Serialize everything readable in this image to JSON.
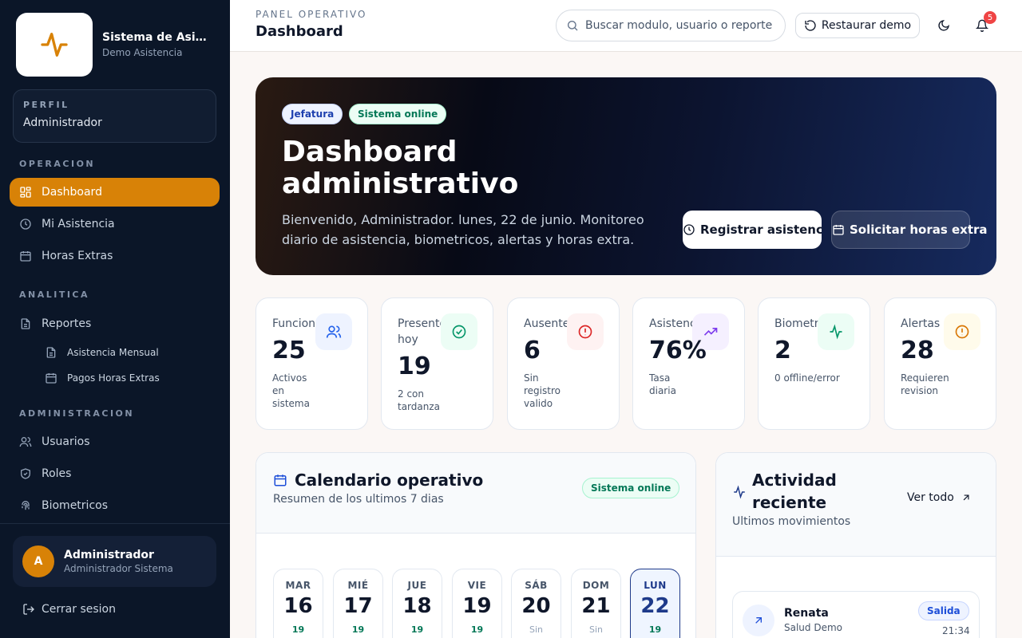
{
  "brand": {
    "title": "Sistema de Asistencia",
    "subtitle": "Demo Asistencia"
  },
  "profile": {
    "label": "PERFIL",
    "value": "Administrador"
  },
  "sidebar": {
    "sections": {
      "operacion": "OPERACION",
      "analitica": "ANALITICA",
      "administracion": "ADMINISTRACION"
    },
    "items": {
      "dashboard": "Dashboard",
      "mi_asistencia": "Mi Asistencia",
      "horas_extras": "Horas Extras",
      "reportes": "Reportes",
      "asistencia_mensual": "Asistencia Mensual",
      "pagos_horas_extras": "Pagos Horas Extras",
      "usuarios": "Usuarios",
      "roles": "Roles",
      "biometricos": "Biometricos"
    },
    "user": {
      "initial": "A",
      "name": "Administrador",
      "role": "Administrador Sistema"
    },
    "logout": "Cerrar sesion"
  },
  "header": {
    "breadcrumb": "PANEL OPERATIVO",
    "title": "Dashboard",
    "search_placeholder": "Buscar modulo, usuario o reporte",
    "restore_label": "Restaurar demo",
    "notification_count": "5"
  },
  "hero": {
    "badge_role": "Jefatura",
    "badge_status": "Sistema online",
    "title": "Dashboard administrativo",
    "description": "Bienvenido, Administrador. lunes, 22 de junio. Monitoreo diario de asistencia, biometricos, alertas y horas extra.",
    "btn_register": "Registrar asistencia",
    "btn_overtime": "Solicitar horas extra"
  },
  "stats": [
    {
      "label": "Funcionarios",
      "value": "25",
      "note": "Activos en sistema",
      "icon": "users-icon",
      "color": "#2563eb"
    },
    {
      "label": "Presentes hoy",
      "value": "19",
      "note": "2 con tardanza",
      "icon": "check-circle-icon",
      "color": "#059669"
    },
    {
      "label": "Ausentes",
      "value": "6",
      "note": "Sin registro valido",
      "icon": "alert-circle-icon",
      "color": "#dc2626"
    },
    {
      "label": "Asistencia",
      "value": "76%",
      "note": "Tasa diaria",
      "icon": "trending-up-icon",
      "color": "#7c3aed"
    },
    {
      "label": "Biometricos",
      "value": "2",
      "note": "0 offline/error",
      "icon": "activity-icon",
      "color": "#059669"
    },
    {
      "label": "Alertas",
      "value": "28",
      "note": "Requieren revision",
      "icon": "alert-circle-icon",
      "color": "#d97706"
    }
  ],
  "calendar": {
    "title": "Calendario operativo",
    "subtitle": "Resumen de los ultimos 7 dias",
    "status": "Sistema online",
    "days": [
      {
        "name": "MAR",
        "num": "16",
        "count": "19"
      },
      {
        "name": "MIÉ",
        "num": "17",
        "count": "19"
      },
      {
        "name": "JUE",
        "num": "18",
        "count": "19"
      },
      {
        "name": "VIE",
        "num": "19",
        "count": "19"
      },
      {
        "name": "SÁB",
        "num": "20",
        "count": "Sin"
      },
      {
        "name": "DOM",
        "num": "21",
        "count": "Sin"
      },
      {
        "name": "LUN",
        "num": "22",
        "count": "19"
      }
    ]
  },
  "activity": {
    "title": "Actividad reciente",
    "subtitle": "Ultimos movimientos",
    "see_all": "Ver todo",
    "items": [
      {
        "name": "Renata",
        "org": "Salud Demo",
        "type": "Salida",
        "time": "21:34"
      }
    ]
  }
}
